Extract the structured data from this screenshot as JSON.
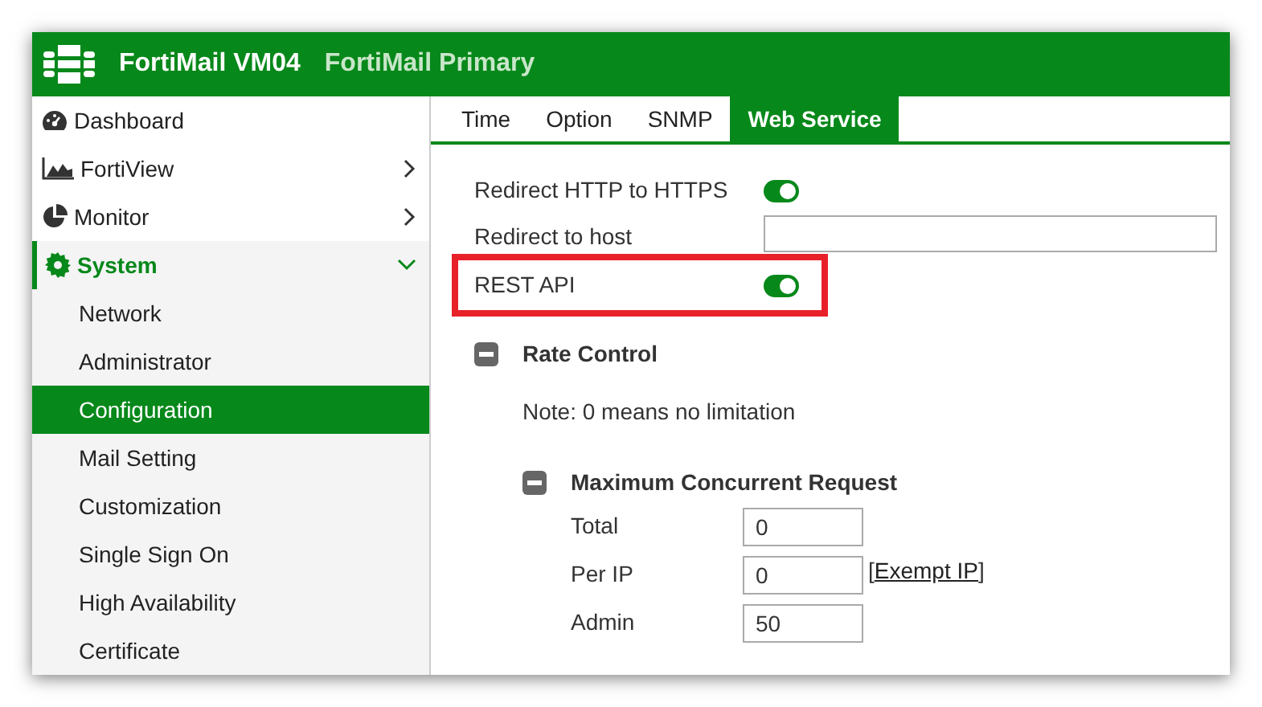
{
  "header": {
    "device": "FortiMail VM04",
    "role": "FortiMail Primary"
  },
  "sidebar": {
    "items": [
      {
        "label": "Dashboard",
        "selected": false
      },
      {
        "label": "FortiView",
        "expanded": false,
        "selected": false
      },
      {
        "label": "Monitor",
        "expanded": false,
        "selected": false
      },
      {
        "label": "System",
        "expanded": true,
        "selected": true,
        "children": [
          {
            "label": "Network",
            "selected": false
          },
          {
            "label": "Administrator",
            "selected": false
          },
          {
            "label": "Configuration",
            "selected": true
          },
          {
            "label": "Mail Setting",
            "selected": false
          },
          {
            "label": "Customization",
            "selected": false
          },
          {
            "label": "Single Sign On",
            "selected": false
          },
          {
            "label": "High Availability",
            "selected": false
          },
          {
            "label": "Certificate",
            "selected": false
          }
        ]
      }
    ]
  },
  "tabs": [
    {
      "label": "Time",
      "selected": false
    },
    {
      "label": "Option",
      "selected": false
    },
    {
      "label": "SNMP",
      "selected": false
    },
    {
      "label": "Web Service",
      "selected": true
    }
  ],
  "settings": [
    {
      "kind": "toggle",
      "label": "Redirect HTTP to HTTPS",
      "on": true,
      "highlighted": false
    },
    {
      "kind": "text",
      "label": "Redirect to host",
      "highlighted": false
    },
    {
      "kind": "toggle",
      "label": "REST API",
      "on": true,
      "highlighted": true
    }
  ],
  "rate_control": {
    "title": "Rate Control",
    "expanded": true,
    "note": "Note: 0 means no limitation",
    "max_concurrent": {
      "title": "Maximum Concurrent Request",
      "expanded": true,
      "fields": [
        {
          "label": "Total",
          "value": "0"
        },
        {
          "label": "Per IP",
          "value": "0",
          "link": {
            "before": "[",
            "label": "Exempt IP",
            "after": "]"
          }
        },
        {
          "label": "Admin",
          "value": "50"
        }
      ]
    }
  }
}
